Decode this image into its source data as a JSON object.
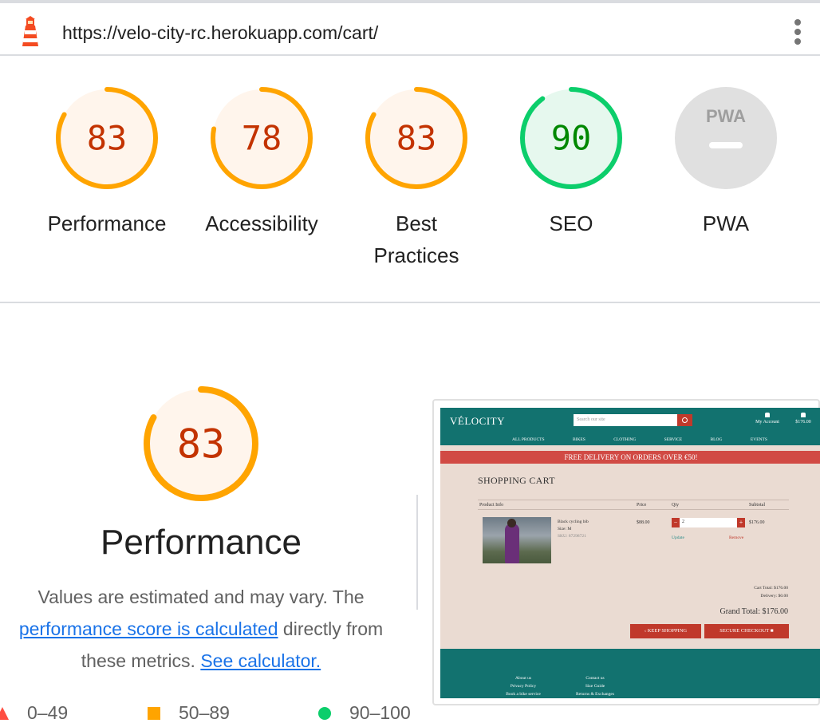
{
  "url_bar": {
    "url": "https://velo-city-rc.herokuapp.com/cart/",
    "logo_icon": "lighthouse-icon",
    "menu_icon": "kebab-menu-icon"
  },
  "colors": {
    "average": "#ffa400",
    "average_text": "#c33300",
    "average_bg": "#fff5ec",
    "pass": "#0cce6b",
    "pass_text": "#008800",
    "pass_bg": "#e6f8ee",
    "fail": "#ff4e42",
    "na": "#e0e0e0"
  },
  "gauges": [
    {
      "score": 83,
      "score_text": "83",
      "label_lines": [
        "Performance"
      ],
      "status": "average"
    },
    {
      "score": 78,
      "score_text": "78",
      "label_lines": [
        "Accessibility"
      ],
      "status": "average"
    },
    {
      "score": 83,
      "score_text": "83",
      "label_lines": [
        "Best",
        "Practices"
      ],
      "status": "average"
    },
    {
      "score": 90,
      "score_text": "90",
      "label_lines": [
        "SEO"
      ],
      "status": "pass"
    },
    {
      "score": null,
      "score_text": "PWA",
      "label_lines": [
        "PWA"
      ],
      "status": "na"
    }
  ],
  "performance": {
    "score": 83,
    "score_text": "83",
    "title": "Performance",
    "desc_part1": "Values are estimated and may vary. The",
    "link1": "performance score is calculated",
    "desc_part2": " directly from these metrics. ",
    "link2": "See calculator."
  },
  "legend": [
    {
      "shape": "triangle",
      "label": "0–49"
    },
    {
      "shape": "square",
      "label": "50–89"
    },
    {
      "shape": "circle",
      "label": "90–100"
    }
  ],
  "screenshot": {
    "logo": "VÉLOCITY",
    "search_placeholder": "Search our site",
    "account": "My Account",
    "bag_total": "$176.00",
    "nav": [
      "ALL PRODUCTS",
      "BIKES",
      "CLOTHING",
      "SERVICE",
      "BLOG",
      "EVENTS"
    ],
    "banner": "FREE DELIVERY ON ORDERS OVER €50!",
    "cart_title": "SHOPPING CART",
    "columns": [
      "Product Info",
      "Price",
      "Qty",
      "Subtotal"
    ],
    "product_name": "Black cycling bib",
    "product_size": "Size: M",
    "product_sku": "SKU: 87298721",
    "price": "$88.00",
    "qty": "2",
    "subtotal": "$176.00",
    "update": "Update",
    "remove": "Remove",
    "cart_total": "Cart Total: $176.00",
    "delivery": "Delivery: $0.00",
    "grand_total": "Grand Total: $176.00",
    "keep_shopping": "KEEP SHOPPING",
    "secure_checkout": "SECURE CHECKOUT",
    "footer_col1": [
      "About us",
      "Privacy Policy",
      "Book a bike service"
    ],
    "footer_col2": [
      "Contact us",
      "Size Guide",
      "Returns & Exchanges"
    ]
  }
}
